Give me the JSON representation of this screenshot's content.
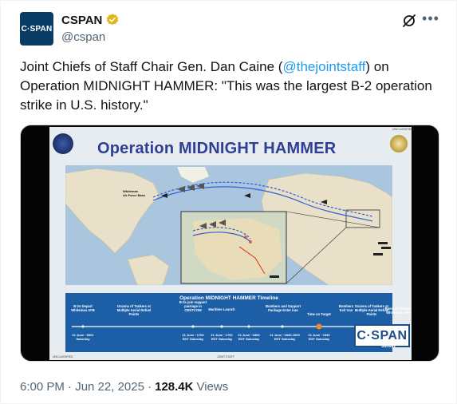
{
  "author": {
    "avatar_text": "C·SPAN",
    "name": "CSPAN",
    "handle": "@cspan"
  },
  "tweet": {
    "text_before": "Joint Chiefs of Staff Chair Gen. Dan Caine (",
    "mention": "@thejointstaff",
    "text_after": ") on Operation MIDNIGHT HAMMER: \"This was the largest B-2 operation strike in U.S. history.\""
  },
  "media": {
    "slide_title": "Operation MIDNIGHT HAMMER",
    "unclassified_top": "UNCLASSIFIED",
    "unclassified_bottom": "UNCLASSIFIED",
    "joint_staff": "JOINT STAFF",
    "map_label_base": "Whiteman\nAir Force Base",
    "timeline_title": "Operation MIDNIGHT HAMMER Timeline",
    "timeline_events": [
      {
        "label": "B-2s Depart Whiteman AFB",
        "date": "21 June ~0001 Saturday"
      },
      {
        "label": "Dozens of Tankers at Multiple Aerial Refuel Points",
        "date": ""
      },
      {
        "label": "B-2s join support package in CENTCOM",
        "date": "21 June ~1700 EDT Saturday"
      },
      {
        "label": "Maritime Launch",
        "date": "21 June ~1700 EDT Saturday"
      },
      {
        "label": "Bombers and Support Package Enter Iran",
        "date": "21 June ~1800 EDT Saturday"
      },
      {
        "label": "Time on Target",
        "date": "21 June ~1840-1905 EDT Saturday"
      },
      {
        "label": "Bombers Exit Iran",
        "date": "21 June ~1930 EDT Saturday"
      },
      {
        "label": "Dozens of Tankers at Multiple Aerial Refuel Points",
        "date": ""
      },
      {
        "label": "Bombers Return Whiteman AFB",
        "date": "Sunday"
      }
    ],
    "watermark": "C·SPAN"
  },
  "footer": {
    "time": "6:00 PM · Jun 22, 2025 ·",
    "views_count": "128.4K",
    "views_label": "Views"
  },
  "colors": {
    "brand_blue": "#1d4f86",
    "link": "#1d9bf0",
    "verified_gold": "#e2b719"
  }
}
